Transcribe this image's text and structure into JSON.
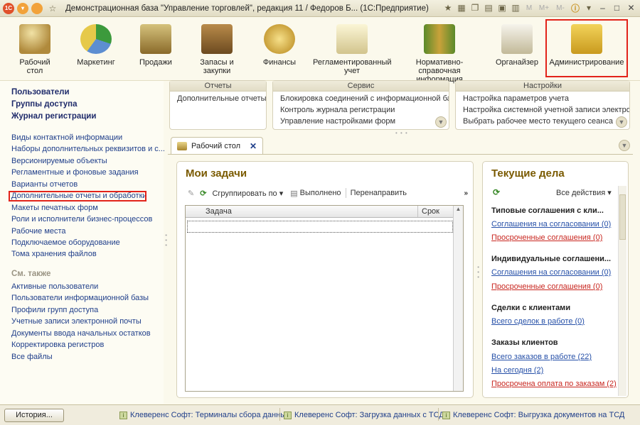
{
  "window": {
    "title": "Демонстрационная база \"Управление торговлей\", редакция 11 / Федоров Б... (1С:Предприятие)",
    "m_label": "M",
    "mplus_label": "M+",
    "mminus_label": "M-"
  },
  "nav": [
    {
      "label": "Рабочий\nстол",
      "icon": "desk-icon"
    },
    {
      "label": "Маркетинг",
      "icon": "pie-chart-icon"
    },
    {
      "label": "Продажи",
      "icon": "truck-icon"
    },
    {
      "label": "Запасы и\nзакупки",
      "icon": "boxes-icon"
    },
    {
      "label": "Финансы",
      "icon": "coins-icon"
    },
    {
      "label": "Регламентированный\nучет",
      "icon": "documents-icon"
    },
    {
      "label": "Нормативно-справочная\nинформация",
      "icon": "binders-icon"
    },
    {
      "label": "Органайзер",
      "icon": "clipboard-icon"
    },
    {
      "label": "Администрирование",
      "icon": "database-computer-icon"
    }
  ],
  "sidebar": {
    "top_links": [
      "Пользователи",
      "Группы доступа",
      "Журнал регистрации"
    ],
    "links": [
      "Виды контактной информации",
      "Наборы дополнительных реквизитов и с...",
      "Версионируемые объекты",
      "Регламентные и фоновые задания",
      "Варианты отчетов",
      "Дополнительные отчеты и обработки",
      "Макеты печатных форм",
      "Роли и исполнители бизнес-процессов",
      "Рабочие места",
      "Подключаемое оборудование",
      "Тома хранения файлов"
    ],
    "see_also_title": "См. также",
    "see_also": [
      "Активные пользователи",
      "Пользователи информационной базы",
      "Профили групп доступа",
      "Учетные записи электронной почты",
      "Документы ввода начальных остатков",
      "Корректировка регистров",
      "Все файлы"
    ]
  },
  "panels": {
    "reports": {
      "title": "Отчеты",
      "items": [
        "Дополнительные отчеты"
      ]
    },
    "service": {
      "title": "Сервис",
      "items": [
        "Блокировка соединений с информационной ба...",
        "Контроль журнала регистрации",
        "Управление настройками форм"
      ]
    },
    "settings": {
      "title": "Настройки",
      "items": [
        "Настройка параметров учета",
        "Настройка системной учетной записи электро...",
        "Выбрать рабочее место текущего сеанса"
      ]
    }
  },
  "tab": {
    "label": "Рабочий стол"
  },
  "tasks": {
    "title": "Мои задачи",
    "group_by": "Сгруппировать по",
    "done": "Выполнено",
    "redirect": "Перенаправить",
    "col_task": "Задача",
    "col_due": "Срок"
  },
  "current": {
    "title": "Текущие дела",
    "all_actions": "Все действия",
    "sections": [
      {
        "title": "Типовые соглашения с кли...",
        "links": [
          {
            "text": "Соглашения на согласовании (0)",
            "kind": "blue"
          },
          {
            "text": "Просроченные соглашения (0)",
            "kind": "red"
          }
        ]
      },
      {
        "title": "Индивидуальные соглашени...",
        "links": [
          {
            "text": "Соглашения на согласовании (0)",
            "kind": "blue"
          },
          {
            "text": "Просроченные соглашения (0)",
            "kind": "red"
          }
        ]
      },
      {
        "title": "Сделки с клиентами",
        "links": [
          {
            "text": "Всего сделок в работе (0)",
            "kind": "blue"
          }
        ]
      },
      {
        "title": "Заказы клиентов",
        "links": [
          {
            "text": "Всего заказов в работе (22)",
            "kind": "blue"
          },
          {
            "text": "На сегодня (2)",
            "kind": "blue"
          },
          {
            "text": "Просрочена оплата по заказам (2)",
            "kind": "red"
          }
        ]
      }
    ]
  },
  "status": {
    "history": "История...",
    "items": [
      "Клеверенс Софт: Терминалы сбора данных",
      "Клеверенс Софт: Загрузка данных с ТСД",
      "Клеверенс Софт: Выгрузка документов на ТСД"
    ]
  },
  "colors": {
    "accent": "#7a5a00",
    "link": "#1f3e8a",
    "red": "#c8261f",
    "highlight": "#e2231a"
  }
}
